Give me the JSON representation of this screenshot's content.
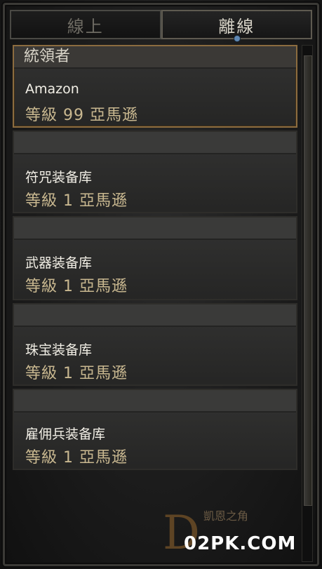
{
  "tabs": [
    {
      "label": "線上",
      "active": false
    },
    {
      "label": "離線",
      "active": true
    }
  ],
  "characters": [
    {
      "role": "統領者",
      "name": "Amazon",
      "level": "等級 99 亞馬遜",
      "selected": true
    },
    {
      "role": "",
      "name": "符咒装备库",
      "level": "等級 1 亞馬遜",
      "selected": false
    },
    {
      "role": "",
      "name": "武器装备库",
      "level": "等級 1 亞馬遜",
      "selected": false
    },
    {
      "role": "",
      "name": "珠宝装备库",
      "level": "等級 1 亞馬遜",
      "selected": false
    },
    {
      "role": "",
      "name": "雇佣兵装备库",
      "level": "等級 1 亞馬遜",
      "selected": false
    }
  ],
  "watermark": {
    "glyph": "D",
    "small_text": "凱恩之角",
    "site": "02PK.COM"
  },
  "colors": {
    "selected_border": "#8c6c3f",
    "level_text": "#c9b890",
    "active_tab_pip": "#5f88b3"
  }
}
